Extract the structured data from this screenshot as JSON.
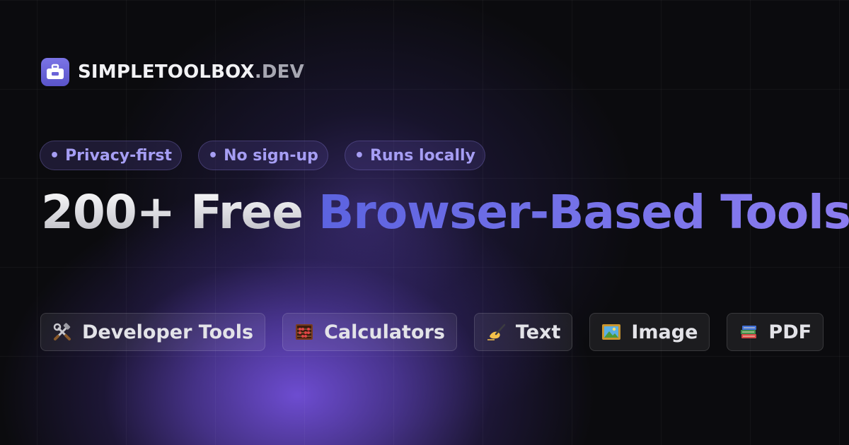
{
  "brand": {
    "name": "SIMPLETOOLBOX",
    "tld": ".DEV",
    "icon": "toolbox-icon",
    "accent": "#6c66dc"
  },
  "badges": [
    {
      "dot": "•",
      "label": "Privacy-first"
    },
    {
      "dot": "•",
      "label": "No sign-up"
    },
    {
      "dot": "•",
      "label": "Runs locally"
    }
  ],
  "headline": {
    "plain": "200+ Free",
    "highlight": "Browser-Based Tools",
    "highlight_color": "#6f6fe6"
  },
  "categories": [
    {
      "icon": "hammer-wrench-icon",
      "label": "Developer Tools"
    },
    {
      "icon": "abacus-icon",
      "label": "Calculators"
    },
    {
      "icon": "writing-hand-icon",
      "label": "Text"
    },
    {
      "icon": "framed-picture-icon",
      "label": "Image"
    },
    {
      "icon": "books-icon",
      "label": "PDF"
    }
  ],
  "colors": {
    "background": "#0b0b0e",
    "glow": "#8558ff",
    "badge_text": "#a69ef4"
  }
}
